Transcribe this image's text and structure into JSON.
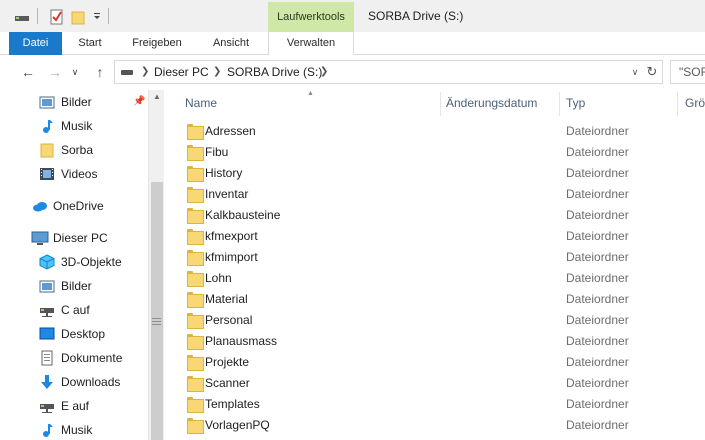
{
  "titlebar": {
    "context_tab": "Laufwerktools",
    "window_title": "SORBA Drive (S:)"
  },
  "ribbon": {
    "tabs": [
      {
        "label": "Datei"
      },
      {
        "label": "Start"
      },
      {
        "label": "Freigeben"
      },
      {
        "label": "Ansicht"
      },
      {
        "label": "Verwalten"
      }
    ]
  },
  "address": {
    "path": [
      "Dieser PC",
      "SORBA Drive (S:)"
    ],
    "search_value": "\"SOR"
  },
  "nav": {
    "items": [
      {
        "label": "Bilder",
        "icon": "pictures-icon"
      },
      {
        "label": "Musik",
        "icon": "music-icon"
      },
      {
        "label": "Sorba",
        "icon": "folder-icon"
      },
      {
        "label": "Videos",
        "icon": "videos-icon"
      },
      {
        "label": "OneDrive",
        "icon": "onedrive-icon"
      },
      {
        "label": "Dieser PC",
        "icon": "this-pc-icon"
      },
      {
        "label": "3D-Objekte",
        "icon": "3d-objects-icon"
      },
      {
        "label": "Bilder",
        "icon": "pictures-icon"
      },
      {
        "label": "C auf",
        "icon": "network-drive-icon"
      },
      {
        "label": "Desktop",
        "icon": "desktop-icon"
      },
      {
        "label": "Dokumente",
        "icon": "documents-icon"
      },
      {
        "label": "Downloads",
        "icon": "downloads-icon"
      },
      {
        "label": "E auf",
        "icon": "network-drive-icon"
      },
      {
        "label": "Musik",
        "icon": "music-icon"
      }
    ]
  },
  "filelist": {
    "columns": [
      "Name",
      "Änderungsdatum",
      "Typ",
      "Grö"
    ],
    "rows": [
      {
        "name": "Adressen",
        "type": "Dateiordner"
      },
      {
        "name": "Fibu",
        "type": "Dateiordner"
      },
      {
        "name": "History",
        "type": "Dateiordner"
      },
      {
        "name": "Inventar",
        "type": "Dateiordner"
      },
      {
        "name": "Kalkbausteine",
        "type": "Dateiordner"
      },
      {
        "name": "kfmexport",
        "type": "Dateiordner"
      },
      {
        "name": "kfmimport",
        "type": "Dateiordner"
      },
      {
        "name": "Lohn",
        "type": "Dateiordner"
      },
      {
        "name": "Material",
        "type": "Dateiordner"
      },
      {
        "name": "Personal",
        "type": "Dateiordner"
      },
      {
        "name": "Planausmass",
        "type": "Dateiordner"
      },
      {
        "name": "Projekte",
        "type": "Dateiordner"
      },
      {
        "name": "Scanner",
        "type": "Dateiordner"
      },
      {
        "name": "Templates",
        "type": "Dateiordner"
      },
      {
        "name": "VorlagenPQ",
        "type": "Dateiordner"
      }
    ]
  },
  "colors": {
    "file_tab": "#1979ca",
    "context_tab": "#cfe8a8",
    "folder_fill": "#f8d775",
    "header_text": "#4c607a"
  }
}
